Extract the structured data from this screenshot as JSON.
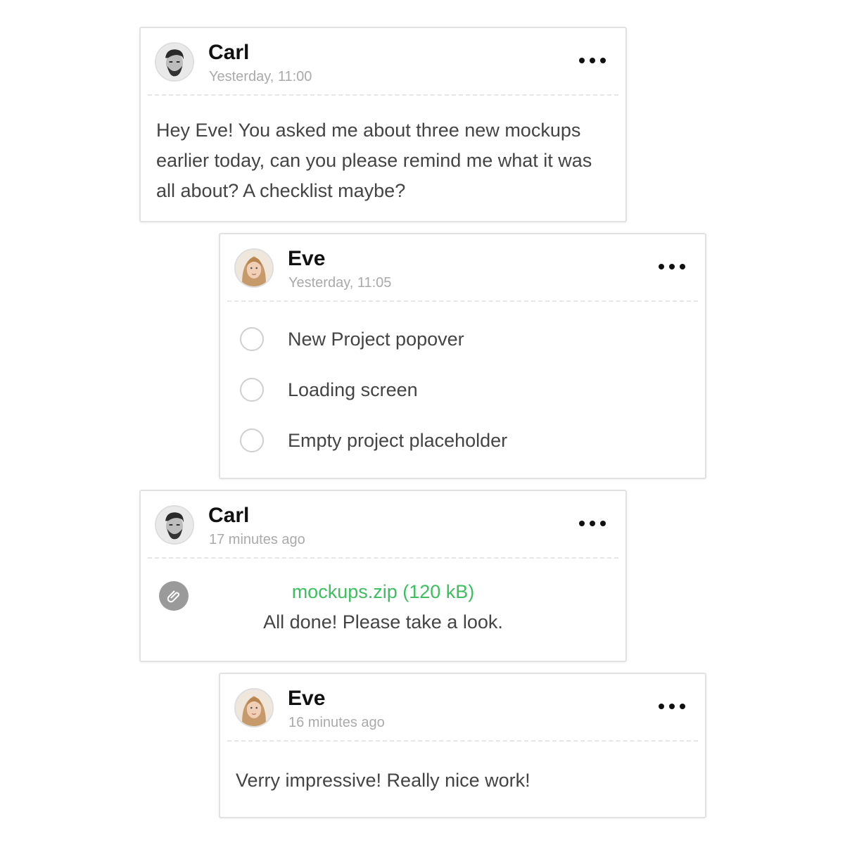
{
  "messages": [
    {
      "author": "Carl",
      "time": "Yesterday, 11:00",
      "text": "Hey Eve! You asked me about three new mockups earlier today, can you please remind me what it was all about? A checklist maybe?"
    },
    {
      "author": "Eve",
      "time": "Yesterday, 11:05",
      "checklist": [
        "New Project popover",
        "Loading screen",
        "Empty project placeholder"
      ]
    },
    {
      "author": "Carl",
      "time": "17 minutes ago",
      "attachment": "mockups.zip (120 kB)",
      "text": "All done! Please take a look."
    },
    {
      "author": "Eve",
      "time": "16 minutes ago",
      "text": "Verry impressive! Really nice work!"
    }
  ],
  "icons": {
    "more": "more-horizontal-icon",
    "attachment": "paperclip-icon",
    "checkbox": "empty-checkbox-circle"
  },
  "colors": {
    "link": "#3dbf5f",
    "timestamp": "#aaaaaa",
    "border": "#e2e2e2"
  }
}
